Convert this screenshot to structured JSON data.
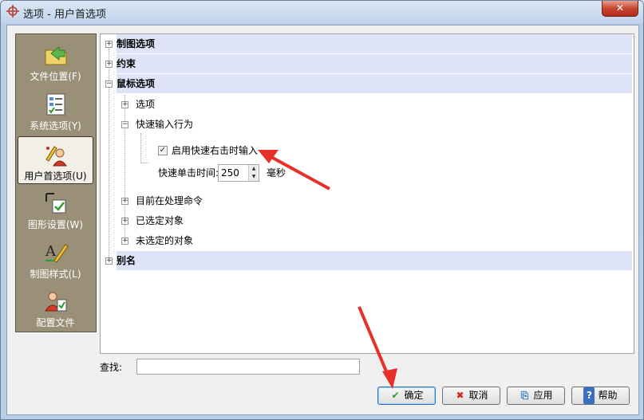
{
  "window": {
    "title": "选项 - 用户首选项",
    "close_label": "✕"
  },
  "left_panel": {
    "items": [
      {
        "label": "文件位置(F)",
        "icon": "folder-arrow-icon"
      },
      {
        "label": "系统选项(Y)",
        "icon": "list-check-icon"
      },
      {
        "label": "用户首选项(U)",
        "icon": "user-pencil-icon",
        "selected": true
      },
      {
        "label": "图形设置(W)",
        "icon": "graphics-check-icon"
      },
      {
        "label": "制图样式(L)",
        "icon": "text-style-icon"
      },
      {
        "label": "配置文件",
        "icon": "user-profile-icon"
      }
    ]
  },
  "tree": {
    "drafting_options": "制图选项",
    "constraints": "约束",
    "mouse_options": "鼠标选项",
    "options": "选项",
    "quick_input_behavior": "快速输入行为",
    "enable_quick_right_click": "启用快速右击时输入",
    "enable_quick_right_click_checked": true,
    "quick_click_time_label": "快速单击时间:",
    "quick_click_time_value": "250",
    "quick_click_time_unit": "毫秒",
    "current_command": "目前在处理命令",
    "selected_objects": "已选定对象",
    "unselected_objects": "未选定的对象",
    "alias": "别名"
  },
  "find": {
    "label": "查找:",
    "value": ""
  },
  "buttons": {
    "ok": "确定",
    "cancel": "取消",
    "apply": "应用",
    "help": "帮助"
  },
  "colors": {
    "header_row": "#dfe3f8",
    "left_panel": "#9a9078",
    "annotation_arrow": "#e8302a"
  }
}
